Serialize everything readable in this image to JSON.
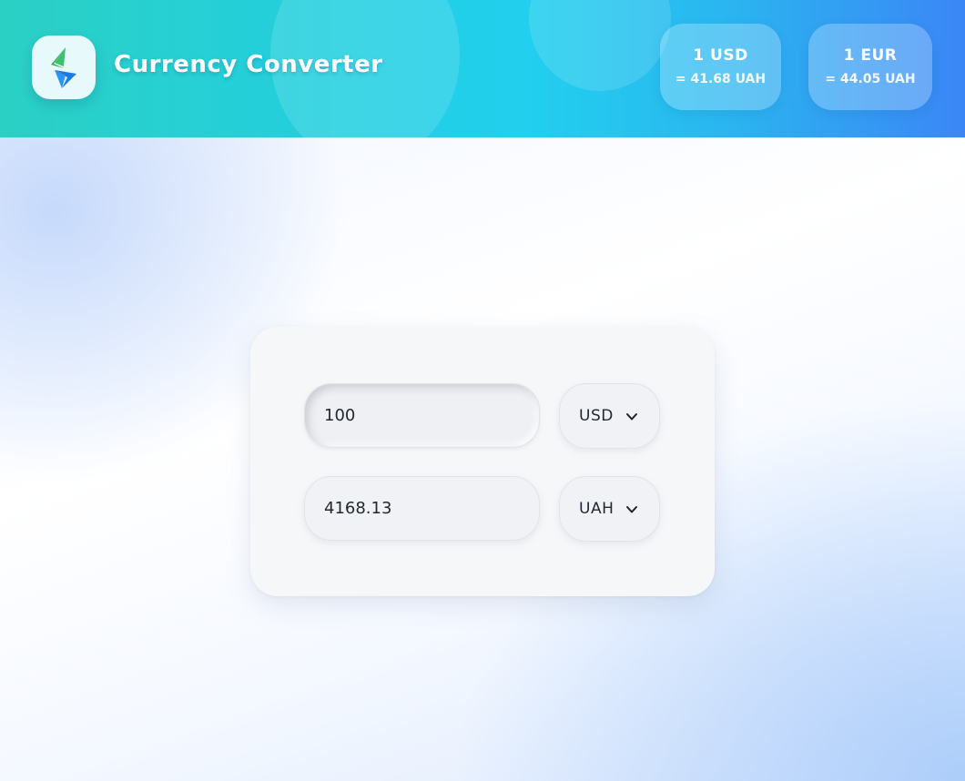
{
  "header": {
    "app_title": "Currency Converter",
    "logo_icon": "exchange-arrows-icon",
    "rates": [
      {
        "currency": "1 USD",
        "value": "= 41.68 UAH"
      },
      {
        "currency": "1 EUR",
        "value": "= 44.05 UAH"
      }
    ]
  },
  "converter": {
    "from": {
      "amount": "100",
      "currency": "USD"
    },
    "to": {
      "amount": "4168.13",
      "currency": "UAH"
    },
    "dropdown_icon": "chevron-down-icon"
  },
  "colors": {
    "header_gradient_start": "#2bd0c4",
    "header_gradient_end": "#3b86f6",
    "panel_background": "#f6f7f9",
    "logo_green": "#2fae5a",
    "logo_blue": "#1f7ae0"
  }
}
